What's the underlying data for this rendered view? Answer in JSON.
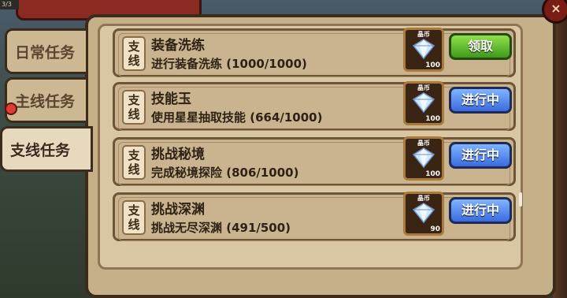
{
  "window": {
    "corner_text": "3/3",
    "close_label": "×"
  },
  "tabs": [
    {
      "label": "日常任务",
      "active": false
    },
    {
      "label": "主线任务",
      "active": false
    },
    {
      "label": "支线任务",
      "active": true
    }
  ],
  "quests": [
    {
      "type": "支\n线",
      "name": "装备洗练",
      "desc": "进行装备洗练 (1000/1000)",
      "reward_label": "晶币",
      "reward_count": "100",
      "button": "领取",
      "button_style": "green"
    },
    {
      "type": "支\n线",
      "name": "技能玉",
      "desc": "使用星星抽取技能 (664/1000)",
      "reward_label": "晶币",
      "reward_count": "100",
      "button": "进行中",
      "button_style": "blue"
    },
    {
      "type": "支\n线",
      "name": "挑战秘境",
      "desc": "完成秘境探险 (806/1000)",
      "reward_label": "晶币",
      "reward_count": "100",
      "button": "进行中",
      "button_style": "blue"
    },
    {
      "type": "支\n线",
      "name": "挑战深渊",
      "desc": "挑战无尽深渊 (491/500)",
      "reward_label": "晶币",
      "reward_count": "90",
      "button": "进行中",
      "button_style": "blue"
    }
  ],
  "icons": {
    "reward": "diamond-gem-icon",
    "close": "close-icon"
  },
  "colors": {
    "claim_button": "#4fb12a",
    "progress_button": "#3a6be0",
    "panel": "#c6b08a"
  }
}
